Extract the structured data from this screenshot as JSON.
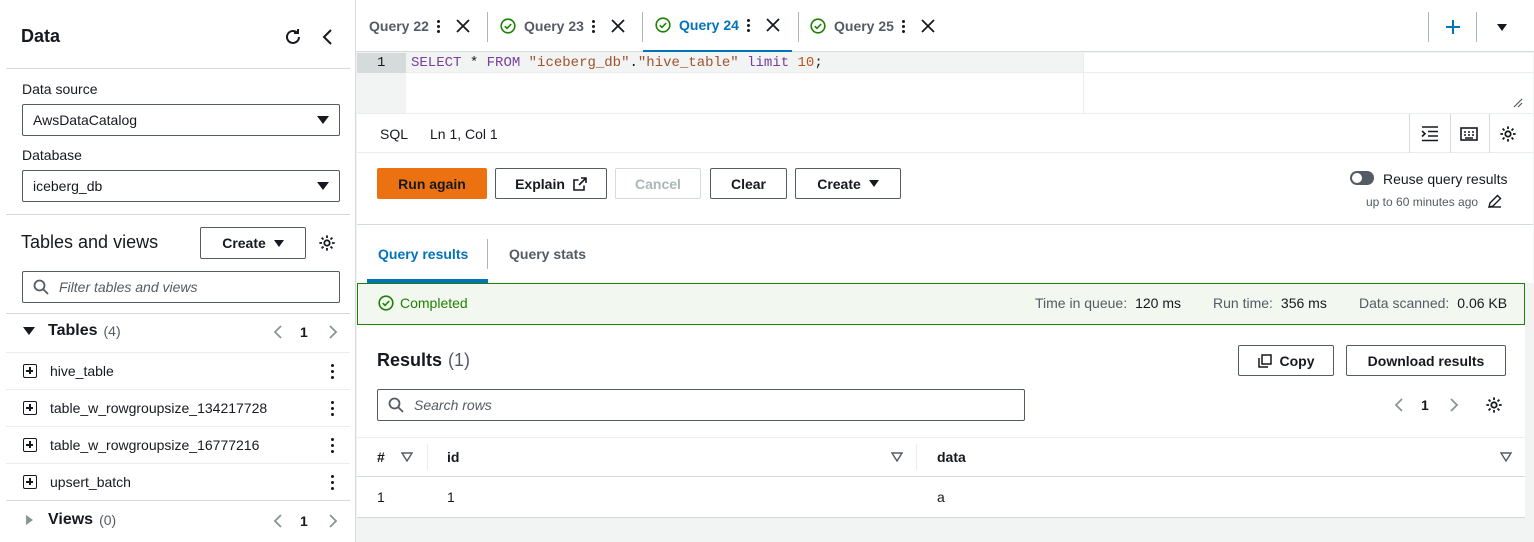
{
  "left_panel": {
    "title": "Data",
    "data_source": {
      "label": "Data source",
      "value": "AwsDataCatalog"
    },
    "database": {
      "label": "Database",
      "value": "iceberg_db"
    },
    "tables_views": {
      "heading": "Tables and views",
      "create_label": "Create"
    },
    "filter": {
      "placeholder": "Filter tables and views"
    },
    "tables": {
      "label": "Tables",
      "count": "(4)",
      "page": "1",
      "items": [
        "hive_table",
        "table_w_rowgroupsize_134217728",
        "table_w_rowgroupsize_16777216",
        "upsert_batch"
      ]
    },
    "views": {
      "label": "Views",
      "count": "(0)",
      "page": "1"
    }
  },
  "query_tabs": [
    {
      "label": "Query 22",
      "status": "none"
    },
    {
      "label": "Query 23",
      "status": "success"
    },
    {
      "label": "Query 24",
      "status": "success",
      "active": true
    },
    {
      "label": "Query 25",
      "status": "success"
    }
  ],
  "editor": {
    "line_number": "1",
    "kw1": "SELECT",
    "star": " * ",
    "kw2": "FROM",
    "str1": "\"iceberg_db\"",
    "dot": ".",
    "str2": "\"hive_table\"",
    "kw3": " limit ",
    "num": "10",
    "semi": ";"
  },
  "status_bar": {
    "language": "SQL",
    "cursor": "Ln 1, Col 1"
  },
  "actions": {
    "run_again": "Run again",
    "explain": "Explain",
    "cancel": "Cancel",
    "clear": "Clear",
    "create": "Create",
    "reuse_label": "Reuse query results",
    "reuse_sub": "up to 60 minutes ago"
  },
  "result_tabs": {
    "results": "Query results",
    "stats": "Query stats"
  },
  "execution": {
    "status": "Completed",
    "queue_label": "Time in queue:",
    "queue_value": "120 ms",
    "run_label": "Run time:",
    "run_value": "356 ms",
    "scanned_label": "Data scanned:",
    "scanned_value": "0.06 KB"
  },
  "results": {
    "title": "Results",
    "count": "(1)",
    "copy": "Copy",
    "download": "Download results",
    "search_placeholder": "Search rows",
    "page": "1",
    "columns": [
      "#",
      "id",
      "data"
    ],
    "rows": [
      [
        "1",
        "1",
        "a"
      ]
    ]
  },
  "colors": {
    "accent": "#0073bb",
    "primary": "#ec7211",
    "success": "#1d8102"
  }
}
